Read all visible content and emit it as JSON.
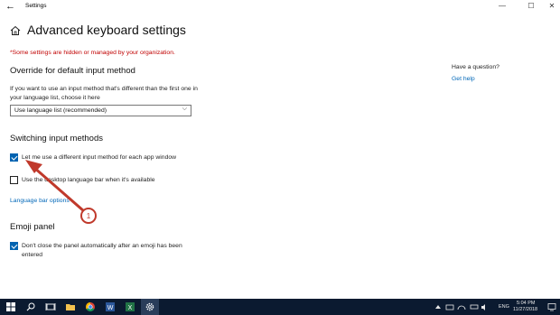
{
  "window": {
    "title": "Settings",
    "back_glyph": "←",
    "min_glyph": "—",
    "max_glyph": "☐",
    "close_glyph": "✕"
  },
  "page": {
    "title": "Advanced keyboard settings",
    "warning": "*Some settings are hidden or managed by your organization."
  },
  "override": {
    "heading": "Override for default input method",
    "description": "If you want to use an input method that's different than the first one in your language list, choose it here",
    "select_value": "Use language list (recommended)",
    "chevron": "⌵"
  },
  "switching": {
    "heading": "Switching input methods",
    "option1": {
      "label": "Let me use a different input method for each app window",
      "checked": true
    },
    "option2": {
      "label": "Use the desktop language bar when it's available",
      "checked": false
    },
    "link": "Language bar options"
  },
  "emoji": {
    "heading": "Emoji panel",
    "option": {
      "label": "Don't close the panel automatically after an emoji has been entered",
      "checked": true
    }
  },
  "sidebar": {
    "question": "Have a question?",
    "help_link": "Get help"
  },
  "annotation": {
    "number": "1",
    "color": "#c0392b"
  },
  "taskbar": {
    "apps": [
      "windows-logo-icon",
      "search-icon",
      "task-view-icon",
      "file-explorer-icon",
      "chrome-icon",
      "word-icon",
      "excel-icon",
      "settings-icon"
    ],
    "language": "ENG",
    "time": "5:04 PM",
    "date": "11/27/2018"
  },
  "colors": {
    "accent": "#0063b1",
    "link": "#0067b8",
    "warning": "#c00000",
    "taskbar": "#0b1a30"
  }
}
